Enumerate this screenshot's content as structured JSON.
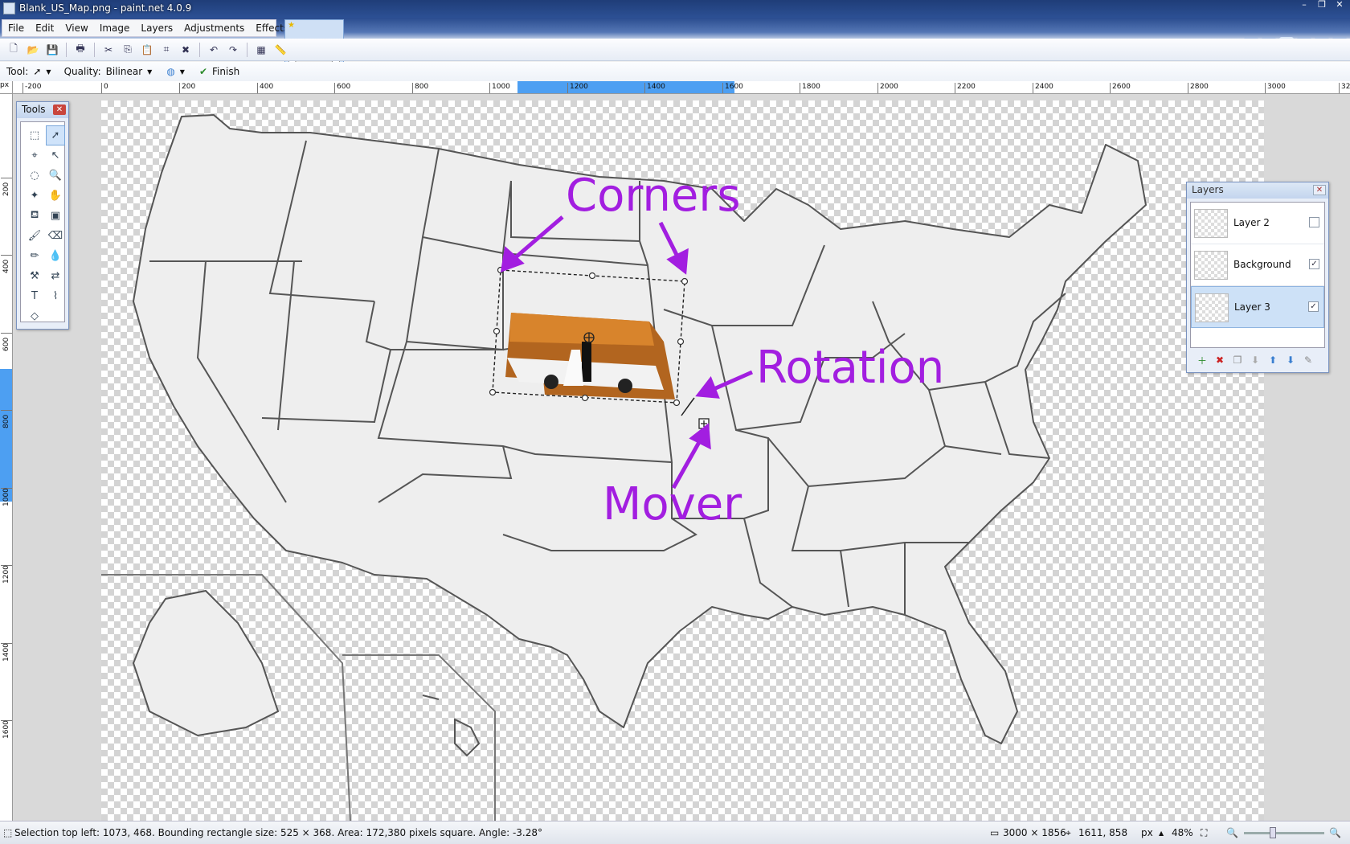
{
  "window": {
    "title": "Blank_US_Map.png - paint.net 4.0.9",
    "controls": [
      "–",
      "❐",
      "✕"
    ]
  },
  "menu": [
    "File",
    "Edit",
    "View",
    "Image",
    "Layers",
    "Adjustments",
    "Effects"
  ],
  "document_tab": {
    "star": "★",
    "dropdown": "⏷"
  },
  "right_toolbar_icons": [
    "tools-icon",
    "history-icon",
    "layers-icon",
    "colors-icon",
    "settings-icon",
    "help-icon"
  ],
  "right_toolbar_glyphs": [
    "✎",
    "◷",
    "▤",
    "◉",
    "⚙",
    "?"
  ],
  "toolbar_icons": [
    "new-icon",
    "open-icon",
    "save-icon",
    "print-icon",
    "cut-icon",
    "copy-icon",
    "paste-icon",
    "crop-icon",
    "deselect-icon",
    "undo-icon",
    "redo-icon",
    "grid-icon",
    "ruler-icon"
  ],
  "toolbar_glyphs": [
    "🗋",
    "📂",
    "💾",
    "🖶",
    "✂",
    "⎘",
    "📋",
    "⌗",
    "✖",
    "↶",
    "↷",
    "▦",
    "📏"
  ],
  "options": {
    "tool_label": "Tool:",
    "quality_label": "Quality:",
    "quality_value": "Bilinear",
    "finish_label": "Finish"
  },
  "ruler": {
    "unit": "px",
    "top_ticks": [
      "-200",
      "0",
      "200",
      "400",
      "600",
      "800",
      "1000",
      "1200",
      "1400",
      "1600",
      "1800",
      "2000",
      "2200",
      "2400",
      "2600",
      "2800",
      "3000",
      "32"
    ],
    "left_ticks": [
      "200",
      "400",
      "600",
      "800",
      "1000",
      "1200",
      "1400",
      "1600"
    ]
  },
  "tools_panel": {
    "title": "Tools",
    "tools": [
      "rectangle-select-icon",
      "move-selected-icon",
      "lasso-icon",
      "move-selection-icon",
      "ellipse-select-icon",
      "zoom-icon",
      "magic-wand-icon",
      "pan-icon",
      "paint-bucket-icon",
      "gradient-icon",
      "paintbrush-icon",
      "eraser-icon",
      "pencil-icon",
      "color-picker-icon",
      "clone-stamp-icon",
      "recolor-icon",
      "text-icon",
      "line-curve-icon",
      "shapes-icon"
    ],
    "glyphs": [
      "⬚",
      "➚",
      "⌖",
      "↖",
      "◌",
      "🔍",
      "✦",
      "✋",
      "⛾",
      "▣",
      "🖌",
      "⌫",
      "✏",
      "💧",
      "⚒",
      "⇄",
      "T",
      "⌇",
      "◇"
    ]
  },
  "annotations": {
    "corners": "Corners",
    "rotation": "Rotation",
    "mover": "Mover"
  },
  "layers_panel": {
    "title": "Layers",
    "layers": [
      {
        "name": "Layer 2",
        "visible": false
      },
      {
        "name": "Background",
        "visible": true
      },
      {
        "name": "Layer 3",
        "visible": true,
        "selected": true
      }
    ],
    "buttons": [
      "add-layer-icon",
      "delete-layer-icon",
      "duplicate-layer-icon",
      "merge-down-icon",
      "move-up-icon",
      "move-down-icon",
      "properties-icon"
    ],
    "button_glyphs": [
      "＋",
      "✖",
      "❐",
      "⬇",
      "⬆",
      "⬇",
      "✎"
    ]
  },
  "status": {
    "selection": "Selection top left: 1073, 468. Bounding rectangle size: 525 × 368. Area: 172,380 pixels square. Angle: -3.28°",
    "image_size": "3000 × 1856",
    "cursor": "1611, 858",
    "unit": "px",
    "zoom": "48%"
  },
  "colors": {
    "annotation": "#a21ee0",
    "ruler_highlight": "#4d9ff2",
    "titlebar": "#1f3d78"
  }
}
